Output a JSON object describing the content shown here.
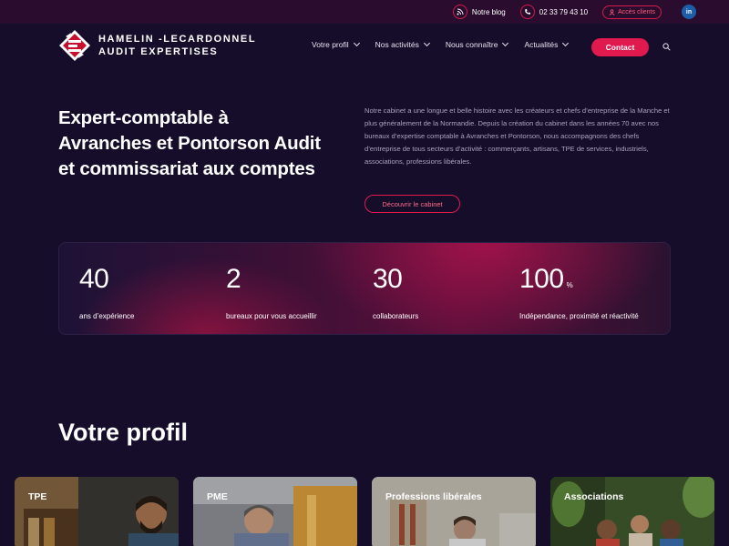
{
  "topbar": {
    "blog_label": "Notre blog",
    "phone": "02 33 79 43 10",
    "client_access": "Accès clients",
    "linkedin": "in"
  },
  "brand": {
    "line1": "HAMELIN -LECARDONNEL",
    "line2": "AUDIT EXPERTISES"
  },
  "nav": {
    "items": [
      {
        "label": "Votre profil"
      },
      {
        "label": "Nos activités"
      },
      {
        "label": "Nous connaître"
      },
      {
        "label": "Actualités"
      }
    ],
    "contact": "Contact"
  },
  "hero": {
    "title": "Expert-comptable à Avranches et Pontorson Audit et commissariat aux comptes",
    "description": "Notre cabinet a une longue et belle histoire avec les créateurs et chefs d’entreprise de la Manche et plus généralement de la Normandie. Depuis la création du cabinet dans les années 70 avec nos bureaux d’expertise comptable à Avranches et Pontorson, nous accompagnons des chefs d’entreprise de tous secteurs d’activité : commerçants, artisans, TPE de services, industriels, associations, professions libérales.",
    "cta": "Découvrir le cabinet"
  },
  "stats": [
    {
      "value": "40",
      "unit": "",
      "label": "ans d’expérience"
    },
    {
      "value": "2",
      "unit": "",
      "label": "bureaux pour vous accueillir"
    },
    {
      "value": "30",
      "unit": "",
      "label": "collaborateurs"
    },
    {
      "value": "100",
      "unit": "%",
      "label": "Indépendance, proximité et réactivité"
    }
  ],
  "profil": {
    "title": "Votre profil",
    "cards": [
      {
        "label": "TPE"
      },
      {
        "label": "PME"
      },
      {
        "label": "Professions libérales"
      },
      {
        "label": "Associations"
      }
    ]
  },
  "colors": {
    "background": "#150d2a",
    "topbar": "#2a0c2e",
    "accent": "#e0194f",
    "muted_text": "#a9a3bd"
  }
}
